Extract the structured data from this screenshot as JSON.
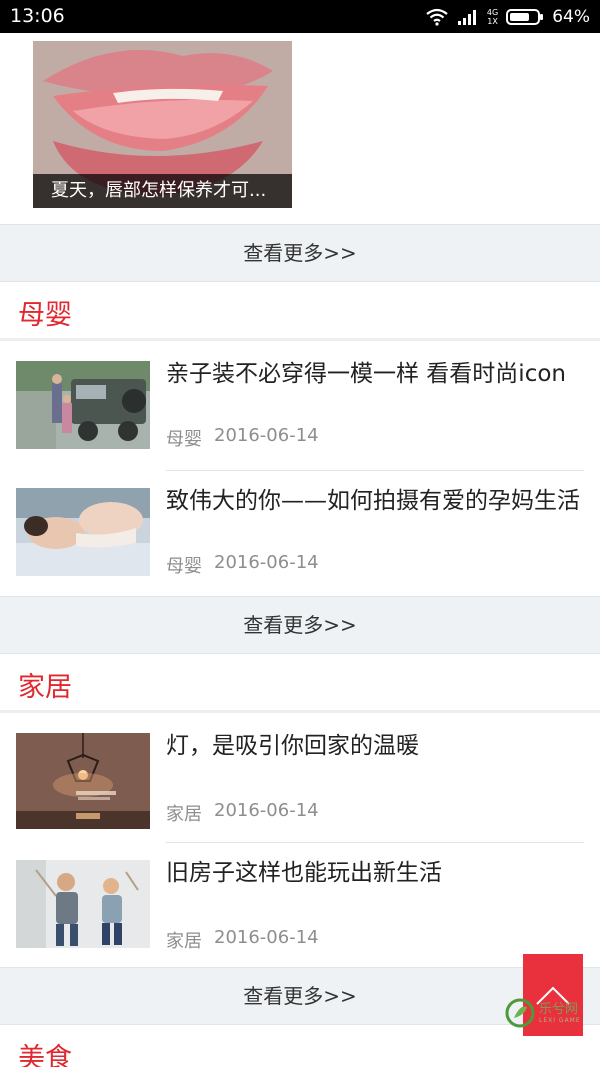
{
  "status_bar": {
    "time": "13:06",
    "network_top": "4G",
    "network_bottom": "1X",
    "battery": "64%"
  },
  "feature": {
    "caption": "夏天，唇部怎样保养才可..."
  },
  "more_label": "查看更多>>",
  "sections": [
    {
      "title": "母婴",
      "articles": [
        {
          "title": "亲子装不必穿得一模一样 看看时尚icon",
          "category": "母婴",
          "date": "2016-06-14"
        },
        {
          "title": "致伟大的你——如何拍摄有爱的孕妈生活",
          "category": "母婴",
          "date": "2016-06-14"
        }
      ]
    },
    {
      "title": "家居",
      "articles": [
        {
          "title": "灯，是吸引你回家的温暖",
          "category": "家居",
          "date": "2016-06-14"
        },
        {
          "title": "旧房子这样也能玩出新生活",
          "category": "家居",
          "date": "2016-06-14"
        }
      ]
    },
    {
      "title": "美食"
    }
  ],
  "watermark": {
    "text": "乐兮网",
    "sub": "LEXI GAME"
  },
  "colors": {
    "accent": "#e0282e",
    "more_bar_bg": "#eff2f5",
    "back_to_top": "#e8313c"
  },
  "icons": [
    "wifi-icon",
    "signal-icon",
    "battery-icon",
    "chevron-up-icon",
    "leaf-logo-icon"
  ]
}
